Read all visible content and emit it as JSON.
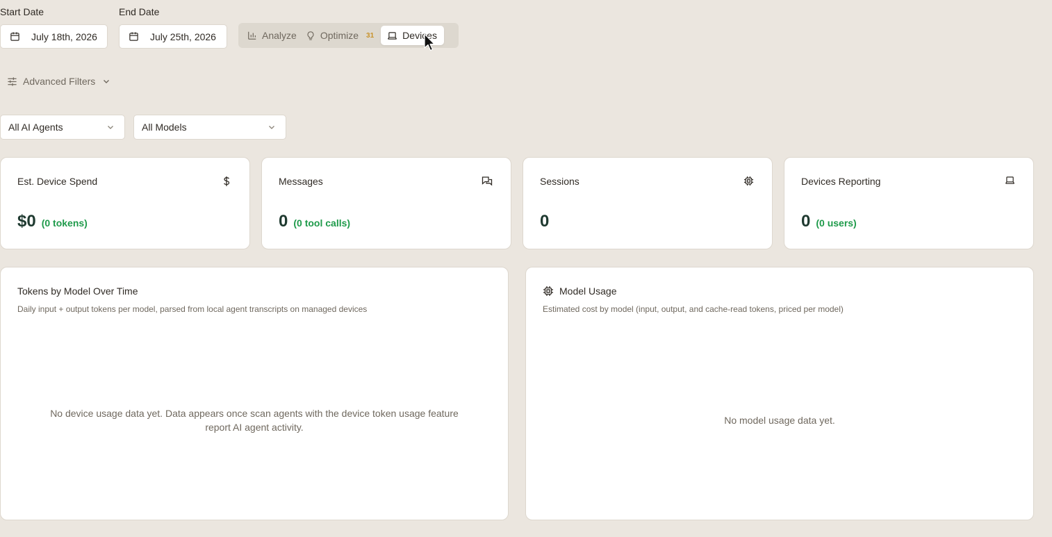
{
  "dates": {
    "start_label": "Start Date",
    "start_value": "July 18th, 2026",
    "end_label": "End Date",
    "end_value": "July 25th, 2026"
  },
  "view_toggle": {
    "analyze": "Analyze",
    "optimize": "Optimize",
    "optimize_badge": "31",
    "devices": "Devices",
    "active": "Devices"
  },
  "filters": {
    "advanced_label": "Advanced Filters",
    "agents_value": "All AI Agents",
    "models_value": "All Models"
  },
  "stats": {
    "spend": {
      "title": "Est. Device Spend",
      "value": "$0",
      "sub": "(0 tokens)",
      "icon": "dollar-icon"
    },
    "messages": {
      "title": "Messages",
      "value": "0",
      "sub": "(0 tool calls)",
      "icon": "chat-bubbles-icon"
    },
    "sessions": {
      "title": "Sessions",
      "value": "0",
      "icon": "cpu-icon"
    },
    "devices": {
      "title": "Devices Reporting",
      "value": "0",
      "sub": "(0 users)",
      "icon": "laptop-icon"
    }
  },
  "panels": {
    "tokens": {
      "title": "Tokens by Model Over Time",
      "desc": "Daily input + output tokens per model, parsed from local agent transcripts on managed devices",
      "empty_line1": "No device usage data yet. Data appears once scan agents with the device token usage feature",
      "empty_line2": "report AI agent activity."
    },
    "models": {
      "title": "Model Usage",
      "desc": "Estimated cost by model (input, output, and cache-read tokens, priced per model)",
      "empty": "No model usage data yet.",
      "icon": "cpu-icon"
    }
  },
  "colors": {
    "background": "#ebe6df",
    "accent_green": "#1e9a4a",
    "badge": "#c8922a",
    "value_dark": "#1f3a30"
  }
}
